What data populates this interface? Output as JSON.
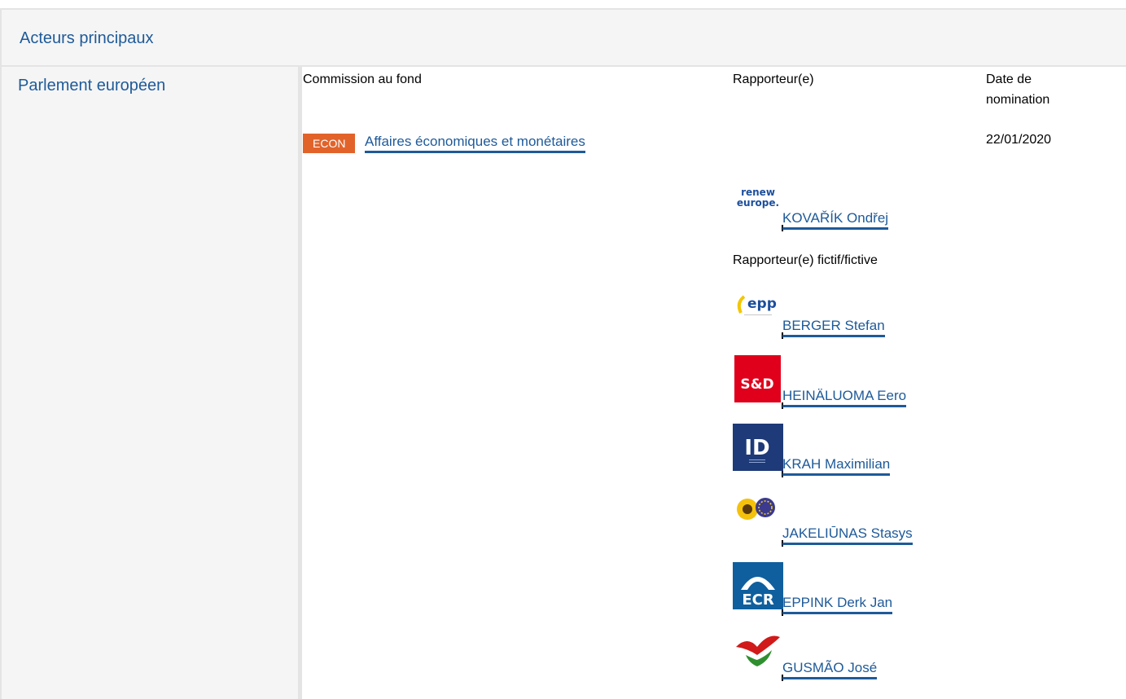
{
  "section": {
    "title": "Acteurs principaux"
  },
  "institution": {
    "name": "Parlement européen"
  },
  "headers": {
    "committee": "Commission au fond",
    "rapporteur": "Rapporteur(e)",
    "date_line1": "Date de",
    "date_line2": "nomination"
  },
  "committee": {
    "code": "ECON",
    "name": "Affaires économiques et monétaires",
    "badge_color": "#e2632a"
  },
  "nomination_date": "22/01/2020",
  "rapporteur": {
    "name": "KOVAŘÍK Ondřej",
    "group_logo_text": [
      "renew",
      "europe."
    ]
  },
  "shadow_label": "Rapporteur(e) fictif/fictive",
  "shadows": [
    {
      "name": "BERGER Stefan",
      "logo": "epp-logo",
      "logo_text": "epp"
    },
    {
      "name": "HEINÄLUOMA Eero",
      "logo": "sd-logo",
      "logo_text": "S&D"
    },
    {
      "name": "KRAH Maximilian",
      "logo": "id-logo",
      "logo_text": "ID"
    },
    {
      "name": "JAKELIŪNAS Stasys",
      "logo": "greens-efa-logo",
      "logo_text": ""
    },
    {
      "name": "EPPINK Derk Jan",
      "logo": "ecr-logo",
      "logo_text": "ECR"
    },
    {
      "name": "GUSMÃO José",
      "logo": "gue-ngl-logo",
      "logo_text": ""
    }
  ],
  "colors": {
    "link": "#1e5a99",
    "header_bg": "#f5f5f5",
    "border": "#e4e4e4"
  }
}
